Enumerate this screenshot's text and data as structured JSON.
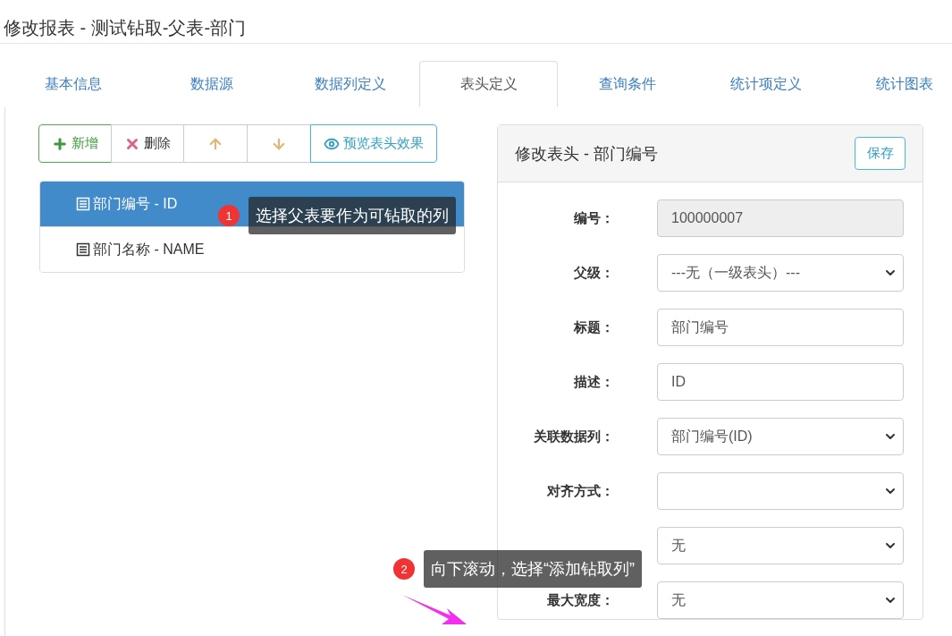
{
  "page_title": "修改报表 - 测试钻取-父表-部门",
  "tabs": [
    {
      "label": "基本信息",
      "selected": false
    },
    {
      "label": "数据源",
      "selected": false
    },
    {
      "label": "数据列定义",
      "selected": false
    },
    {
      "label": "表头定义",
      "selected": true
    },
    {
      "label": "查询条件",
      "selected": false
    },
    {
      "label": "统计项定义",
      "selected": false
    },
    {
      "label": "统计图表",
      "selected": false
    }
  ],
  "toolbar": [
    {
      "kind": "add",
      "label": "新增"
    },
    {
      "kind": "delete",
      "label": "删除"
    },
    {
      "kind": "up"
    },
    {
      "kind": "down"
    },
    {
      "kind": "preview",
      "label": "预览表头效果"
    }
  ],
  "columns": [
    {
      "label": "部门编号 - ID",
      "selected": true
    },
    {
      "label": "部门名称 - NAME",
      "selected": false
    }
  ],
  "editor": {
    "title": "修改表头 - 部门编号",
    "save": "保存",
    "fields": [
      {
        "kind": "readonly",
        "label": "编号：",
        "value": "100000007"
      },
      {
        "kind": "select",
        "label": "父级：",
        "value": "---无（一级表头）---"
      },
      {
        "kind": "text",
        "label": "标题：",
        "value": "部门编号"
      },
      {
        "kind": "text",
        "label": "描述：",
        "value": "ID"
      },
      {
        "kind": "select",
        "label": "关联数据列：",
        "value": "部门编号(ID)"
      },
      {
        "kind": "select",
        "label": "对齐方式："
      },
      {
        "kind": "select",
        "value": "无"
      },
      {
        "kind": "select",
        "label": "最大宽度：",
        "value": "无"
      }
    ]
  },
  "callouts": [
    {
      "number": "1",
      "text": "选择父表要作为可钻取的列"
    },
    {
      "number": "2",
      "text": "向下滚动，选择“添加钻取列”"
    }
  ]
}
